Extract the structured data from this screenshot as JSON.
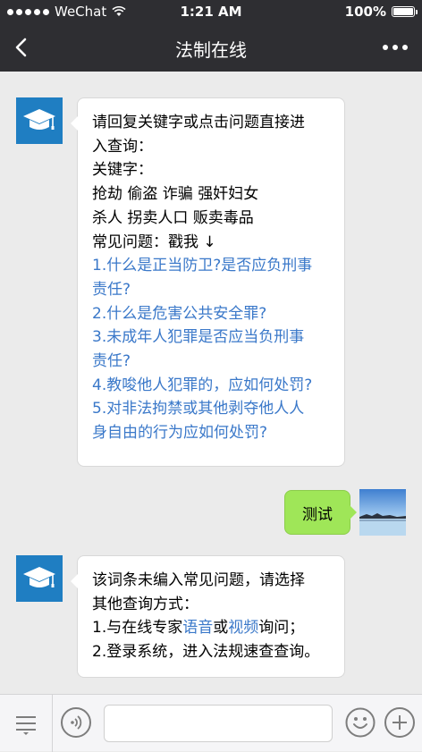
{
  "status": {
    "carrier": "WeChat",
    "time": "1:21 AM",
    "battery": "100%"
  },
  "nav": {
    "title": "法制在线"
  },
  "messages": {
    "first": {
      "lines": [
        "请回复关键字或点击问题直接进",
        "入查询：",
        "关键字：",
        "抢劫 偷盗 诈骗 强奸妇女",
        "杀人 拐卖人口 贩卖毒品",
        "常见问题：戳我 ↓"
      ],
      "links": [
        "1.什么是正当防卫?是否应负刑事",
        "责任?",
        "2.什么是危害公共安全罪?",
        "3.未成年人犯罪是否应当负刑事",
        "责任?",
        "4.教唆他人犯罪的，应如何处罚?",
        "5.对非法拘禁或其他剥夺他人人",
        "身自由的行为应如何处罚?"
      ]
    },
    "user": {
      "text": "测试"
    },
    "second": {
      "line1": "该词条未编入常见问题，请选择",
      "line2": "其他查询方式：",
      "line3_pre": "1.与在线专家",
      "line3_link1": "语音",
      "line3_mid": "或",
      "line3_link2": "视频",
      "line3_post": "询问；",
      "line4": "2.登录系统，进入法规速查查询。"
    }
  },
  "colors": {
    "nav": "#2e2e32",
    "bot_avatar": "#1f7ec2",
    "user_bubble": "#9fe658",
    "link": "#3a78c9",
    "background": "#ebebeb"
  },
  "icons": {
    "back": "chevron-left-icon",
    "more": "more-dots-icon",
    "bot": "graduation-cap-icon",
    "menu": "list-menu-icon",
    "voice": "voice-icon",
    "emoji": "emoji-icon",
    "plus": "plus-icon"
  }
}
